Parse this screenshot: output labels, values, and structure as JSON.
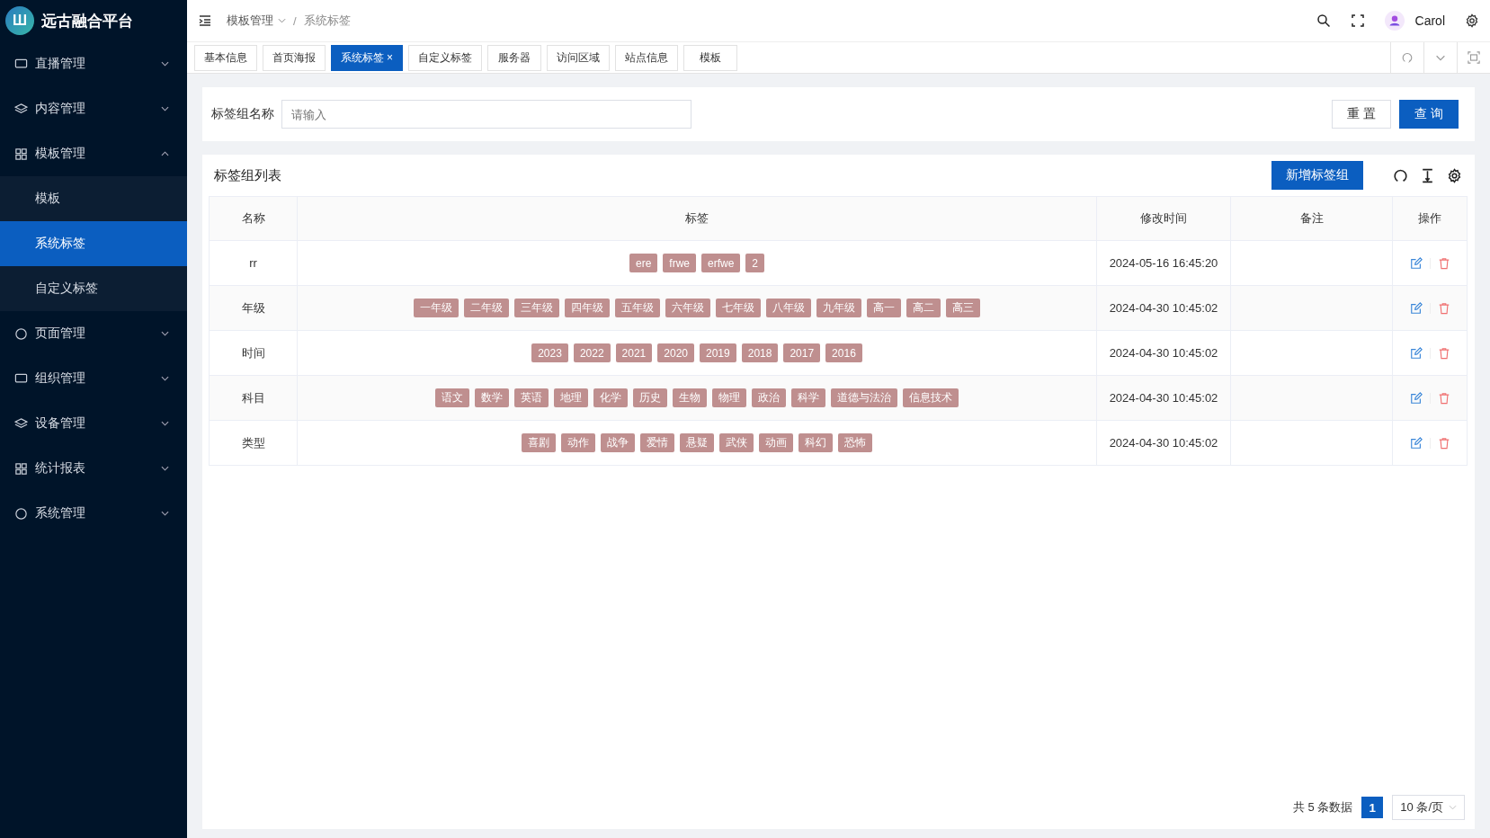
{
  "app": {
    "title": "远古融合平台",
    "logo_text": "Ш"
  },
  "sidebar": {
    "items": [
      {
        "label": "直播管理",
        "expanded": false
      },
      {
        "label": "内容管理",
        "expanded": false
      },
      {
        "label": "模板管理",
        "expanded": true,
        "children": [
          {
            "label": "模板",
            "selected": false
          },
          {
            "label": "系统标签",
            "selected": true
          },
          {
            "label": "自定义标签",
            "selected": false
          }
        ]
      },
      {
        "label": "页面管理",
        "expanded": false
      },
      {
        "label": "组织管理",
        "expanded": false
      },
      {
        "label": "设备管理",
        "expanded": false
      },
      {
        "label": "统计报表",
        "expanded": false
      },
      {
        "label": "系统管理",
        "expanded": false
      }
    ]
  },
  "header": {
    "breadcrumb": [
      "模板管理",
      "系统标签"
    ],
    "separator": "/",
    "user": "Carol"
  },
  "tabs": [
    {
      "label": "基本信息",
      "selected": false
    },
    {
      "label": "首页海报",
      "selected": false
    },
    {
      "label": "系统标签",
      "selected": true,
      "close": "×"
    },
    {
      "label": "自定义标签",
      "selected": false
    },
    {
      "label": "服务器",
      "selected": false
    },
    {
      "label": "访问区域",
      "selected": false
    },
    {
      "label": "站点信息",
      "selected": false
    },
    {
      "label": "模板",
      "selected": false
    }
  ],
  "filter": {
    "label": "标签组名称",
    "placeholder": "请输入",
    "buttons": [
      "重 置",
      "查 询"
    ]
  },
  "table": {
    "title": "标签组列表",
    "add_button": "新增标签组",
    "columns": [
      "名称",
      "标签",
      "修改时间",
      "备注",
      "操作"
    ],
    "rows": [
      {
        "name": "rr",
        "tags": [
          "ere",
          "frwe",
          "erfwe",
          "2"
        ],
        "modified": "2024-05-16 16:45:20"
      },
      {
        "name": "年级",
        "tags": [
          "一年级",
          "二年级",
          "三年级",
          "四年级",
          "五年级",
          "六年级",
          "七年级",
          "八年级",
          "九年级",
          "高一",
          "高二",
          "高三"
        ],
        "modified": "2024-04-30 10:45:02"
      },
      {
        "name": "时间",
        "tags": [
          "2023",
          "2022",
          "2021",
          "2020",
          "2019",
          "2018",
          "2017",
          "2016"
        ],
        "modified": "2024-04-30 10:45:02"
      },
      {
        "name": "科目",
        "tags": [
          "语文",
          "数学",
          "英语",
          "地理",
          "化学",
          "历史",
          "生物",
          "物理",
          "政治",
          "科学",
          "道德与法治",
          "信息技术"
        ],
        "modified": "2024-04-30 10:45:02"
      },
      {
        "name": "类型",
        "tags": [
          "喜剧",
          "动作",
          "战争",
          "爱情",
          "悬疑",
          "武侠",
          "动画",
          "科幻",
          "恐怖"
        ],
        "modified": "2024-04-30 10:45:02"
      }
    ]
  },
  "pagination": {
    "total": "共 5 条数据",
    "pages": [
      {
        "label": "1",
        "selected": true
      }
    ],
    "page_size": "10 条/页"
  }
}
